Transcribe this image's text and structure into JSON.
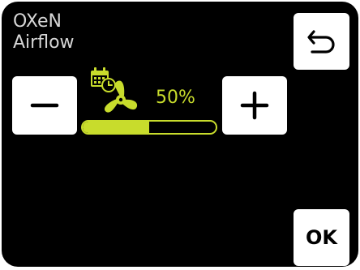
{
  "header": {
    "device": "OXeN",
    "screen": "Airflow"
  },
  "airflow": {
    "percent_label": "50%",
    "level_fraction": 0.5
  },
  "buttons": {
    "back_icon": "undo-arrow-icon",
    "minus_icon": "minus-icon",
    "plus_icon": "plus-icon",
    "ok_label": "OK"
  },
  "icons": {
    "schedule": "calendar-clock-icon",
    "fan": "fan-icon"
  },
  "colors": {
    "background": "#000000",
    "accent": "#c8dc2c",
    "button": "#ffffff",
    "text": "#d6d6d6"
  }
}
